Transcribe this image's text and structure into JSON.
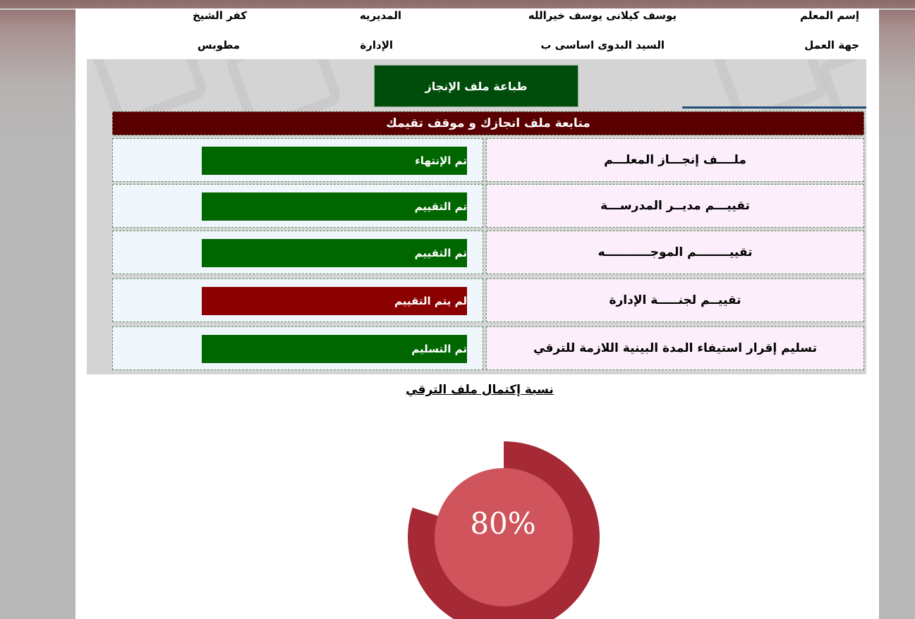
{
  "header": {
    "teacher_label": "إسم المعلم",
    "teacher_name": "يوسف كيلانى يوسف خيرالله",
    "directorate_label": "المديريه",
    "directorate_value": "كفر الشيخ",
    "workplace_label": "جهة العمل",
    "workplace_value": "السيد البدوى اساسى ب",
    "administration_label": "الإدارة",
    "administration_value": "مطوبس"
  },
  "print_button": "طباعة ملف الإنجاز",
  "table": {
    "title": "متابعة  ملف انجازك و موقف تقيمك",
    "rows": [
      {
        "label": "ملــــف إنجـــاز المعلـــم",
        "status": "تم الإنتهاء",
        "state": "ok"
      },
      {
        "label": "تقييـــم مديــر المدرســـة",
        "status": "تم التقييم",
        "state": "ok"
      },
      {
        "label": "تقييــــــــم الموجـــــــــــه",
        "status": "تم التقييم",
        "state": "ok"
      },
      {
        "label": "تقييــم لجنـــــة الإدارة",
        "status": "لم يتم التقييم",
        "state": "bad"
      },
      {
        "label": "تسليم إقرار استيفاء المدة البينية اللازمة للترقي",
        "status": "تم التسليم",
        "state": "ok"
      }
    ]
  },
  "completion": {
    "label": "نسبة إكتمال ملف الترقي",
    "value_text": "80%",
    "value": 0.8
  },
  "colors": {
    "ok": "#006600",
    "bad": "#8b0000",
    "title_bar": "#5a0000",
    "donut_outer": "#a52a36",
    "donut_inner": "#cf545b"
  }
}
